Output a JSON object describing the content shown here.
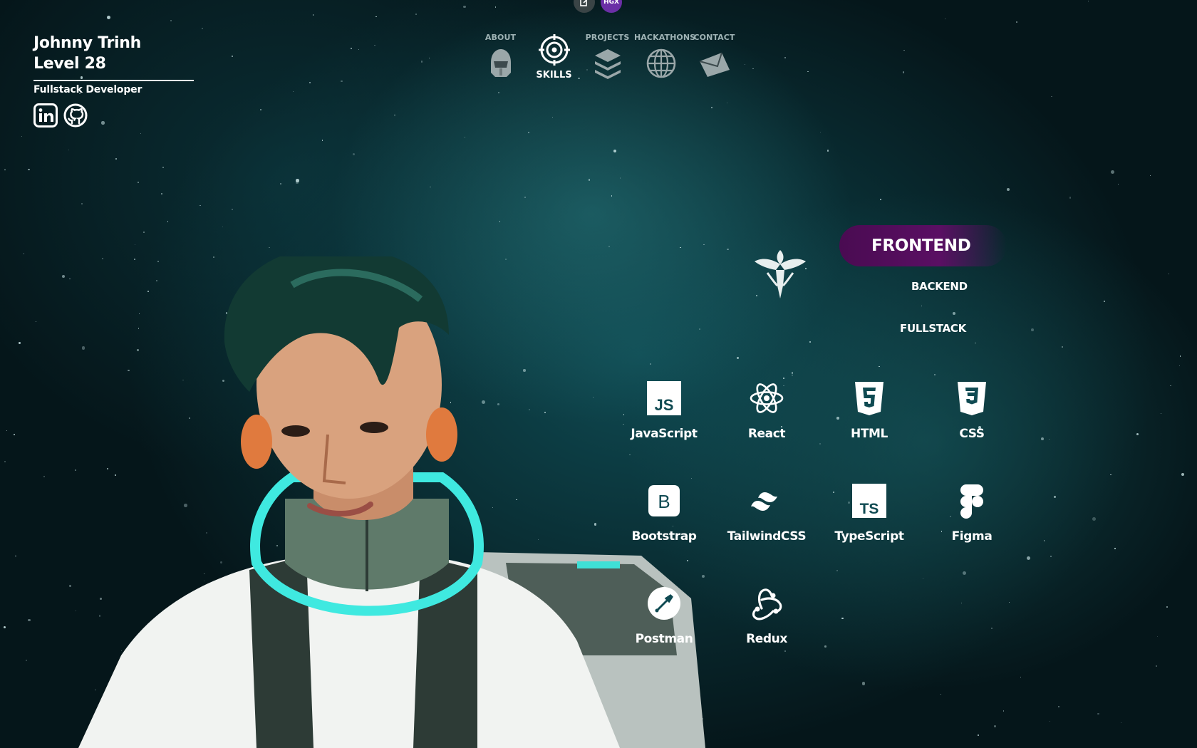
{
  "profile": {
    "name": "Johnny Trinh",
    "level": "Level 28",
    "role": "Fullstack Developer",
    "socials": [
      "linkedin-icon",
      "github-icon"
    ]
  },
  "top_badges": {
    "second": "HGX"
  },
  "nav": {
    "items": [
      {
        "label": "ABOUT",
        "icon": "helmet-icon"
      },
      {
        "label": "SKILLS",
        "icon": "target-icon",
        "active": true
      },
      {
        "label": "PROJECTS",
        "icon": "layers-icon"
      },
      {
        "label": "HACKATHONS",
        "icon": "globe-icon"
      },
      {
        "label": "CONTACT",
        "icon": "mail-icon"
      }
    ]
  },
  "categories": {
    "active": "FRONTEND",
    "backend": "BACKEND",
    "fullstack": "FULLSTACK"
  },
  "skills": [
    {
      "label": "JavaScript",
      "icon": "javascript-icon"
    },
    {
      "label": "React",
      "icon": "react-icon"
    },
    {
      "label": "HTML",
      "icon": "html-icon"
    },
    {
      "label": "CSS",
      "icon": "css-icon"
    },
    {
      "label": "Bootstrap",
      "icon": "bootstrap-icon"
    },
    {
      "label": "TailwindCSS",
      "icon": "tailwind-icon"
    },
    {
      "label": "TypeScript",
      "icon": "typescript-icon"
    },
    {
      "label": "Figma",
      "icon": "figma-icon"
    },
    {
      "label": "Postman",
      "icon": "postman-icon"
    },
    {
      "label": "Redux",
      "icon": "redux-icon"
    }
  ],
  "colors": {
    "accent": "#5a0f63",
    "background": "#0f4a52"
  }
}
